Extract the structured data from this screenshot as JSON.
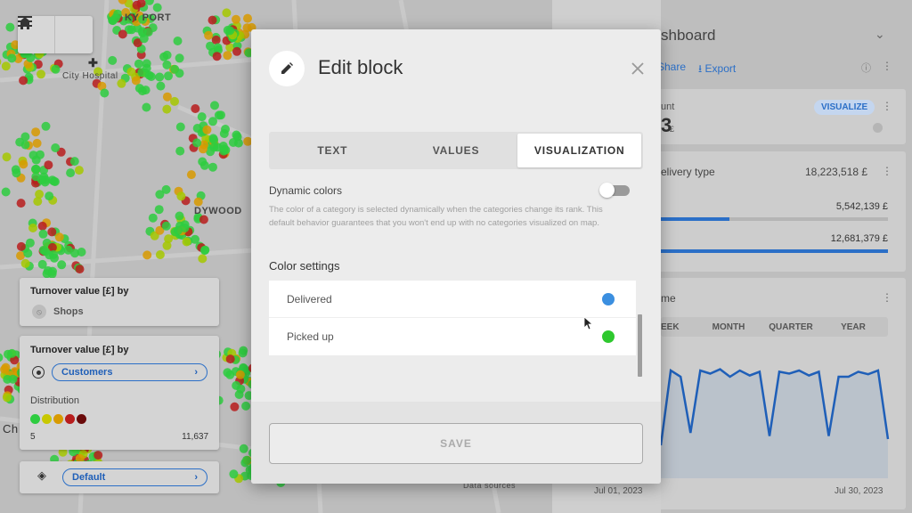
{
  "map": {
    "labels": {
      "port": "KY PORT",
      "hospital": "City Hospital",
      "wood": "DYWOOD",
      "edge_c": "Ch",
      "bottom_text": "Data sources"
    },
    "buttons": {
      "menu_icon": "hamburger-icon",
      "home_icon": "home-icon"
    },
    "panels": {
      "shops": {
        "title": "Turnover value [£] by",
        "label": "Shops"
      },
      "customers": {
        "title": "Turnover value [£] by",
        "chip": "Customers",
        "distribution_label": "Distribution",
        "min": "5",
        "max": "11,637",
        "legend_colors": [
          "#2ecc40",
          "#c8c800",
          "#d89a00",
          "#b81d1d",
          "#6a0a0a"
        ]
      },
      "layers": {
        "chip": "Default"
      }
    }
  },
  "dashboard": {
    "title": "shboard",
    "share": "Share",
    "export": "Export",
    "count_card": {
      "label": "unt",
      "value": "3",
      "unit": "£",
      "visualize": "VISUALIZE"
    },
    "delivery_card": {
      "label": "elivery type",
      "total": "18,223,518 £",
      "rows": [
        {
          "value": "5,542,139 £",
          "fraction": 0.3
        },
        {
          "value": "12,681,379 £",
          "fraction": 1.0
        }
      ]
    },
    "time_card": {
      "label": "me",
      "periods": [
        "EEK",
        "MONTH",
        "QUARTER",
        "YEAR"
      ],
      "start_date": "Jul 01, 2023",
      "end_date": "Jul 30, 2023"
    }
  },
  "modal": {
    "title": "Edit block",
    "tabs": [
      {
        "label": "TEXT",
        "active": false
      },
      {
        "label": "VALUES",
        "active": false
      },
      {
        "label": "VISUALIZATION",
        "active": true
      }
    ],
    "dynamic_colors": {
      "title": "Dynamic colors",
      "description": "The color of a category is selected dynamically when the categories change its rank. This default behavior guarantees that you won't end up with no categories visualized on map."
    },
    "color_settings": {
      "title": "Color settings",
      "items": [
        {
          "label": "Delivered",
          "color": "#3b8fe0"
        },
        {
          "label": "Picked up",
          "color": "#2ec82e"
        }
      ]
    },
    "save_label": "SAVE"
  },
  "colors": {
    "accent": "#2b6fc7",
    "series_line": "#1f5fb8"
  }
}
